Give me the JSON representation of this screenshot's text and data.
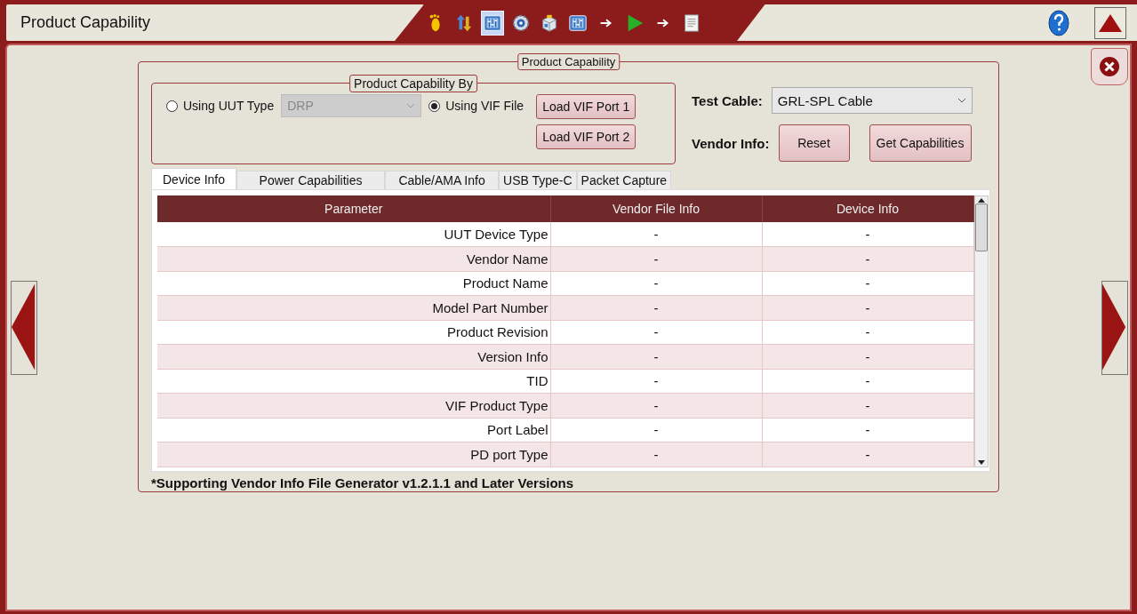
{
  "window": {
    "title": "Product Capability"
  },
  "toolbar": [
    {
      "kind": "footprint",
      "selected": false
    },
    {
      "kind": "updown",
      "selected": false
    },
    {
      "kind": "sliders",
      "selected": true
    },
    {
      "kind": "gear",
      "selected": false
    },
    {
      "kind": "box",
      "selected": false
    },
    {
      "kind": "sliders",
      "selected": false
    },
    {
      "kind": "arrow",
      "selected": false
    },
    {
      "kind": "play",
      "selected": false
    },
    {
      "kind": "arrow",
      "selected": false
    },
    {
      "kind": "report",
      "selected": false
    }
  ],
  "panel": {
    "title": "Product Capability",
    "by": {
      "title": "Product Capability By",
      "options": [
        {
          "label": "Using UUT Type",
          "selected": false
        },
        {
          "label": "Using VIF File",
          "selected": true
        }
      ],
      "uut_type": {
        "value": "DRP",
        "disabled": true
      },
      "buttons": [
        "Load VIF Port 1",
        "Load VIF Port 2"
      ]
    },
    "test_cable": {
      "label": "Test Cable:",
      "value": "GRL-SPL Cable"
    },
    "vendor_info": {
      "label": "Vendor Info:",
      "buttons": [
        "Reset",
        "Get Capabilities"
      ]
    },
    "tabs": [
      {
        "label": "Device Info",
        "selected": true
      },
      {
        "label": "Power Capabilities",
        "selected": false
      },
      {
        "label": "Cable/AMA Info",
        "selected": false
      },
      {
        "label": "USB Type-C",
        "selected": false
      },
      {
        "label": "Packet Capture",
        "selected": false
      }
    ],
    "table": {
      "columns": [
        "Parameter",
        "Vendor File Info",
        "Device Info"
      ],
      "rows": [
        [
          "UUT Device Type",
          "-",
          "-"
        ],
        [
          "Vendor Name",
          "-",
          "-"
        ],
        [
          "Product Name",
          "-",
          "-"
        ],
        [
          "Model Part Number",
          "-",
          "-"
        ],
        [
          "Product Revision",
          "-",
          "-"
        ],
        [
          "Version Info",
          "-",
          "-"
        ],
        [
          "TID",
          "-",
          "-"
        ],
        [
          "VIF Product Type",
          "-",
          "-"
        ],
        [
          "Port Label",
          "-",
          "-"
        ],
        [
          "PD port Type",
          "-",
          "-"
        ]
      ]
    },
    "footnote": "*Supporting Vendor Info File Generator v1.2.1.1 and Later Versions"
  }
}
